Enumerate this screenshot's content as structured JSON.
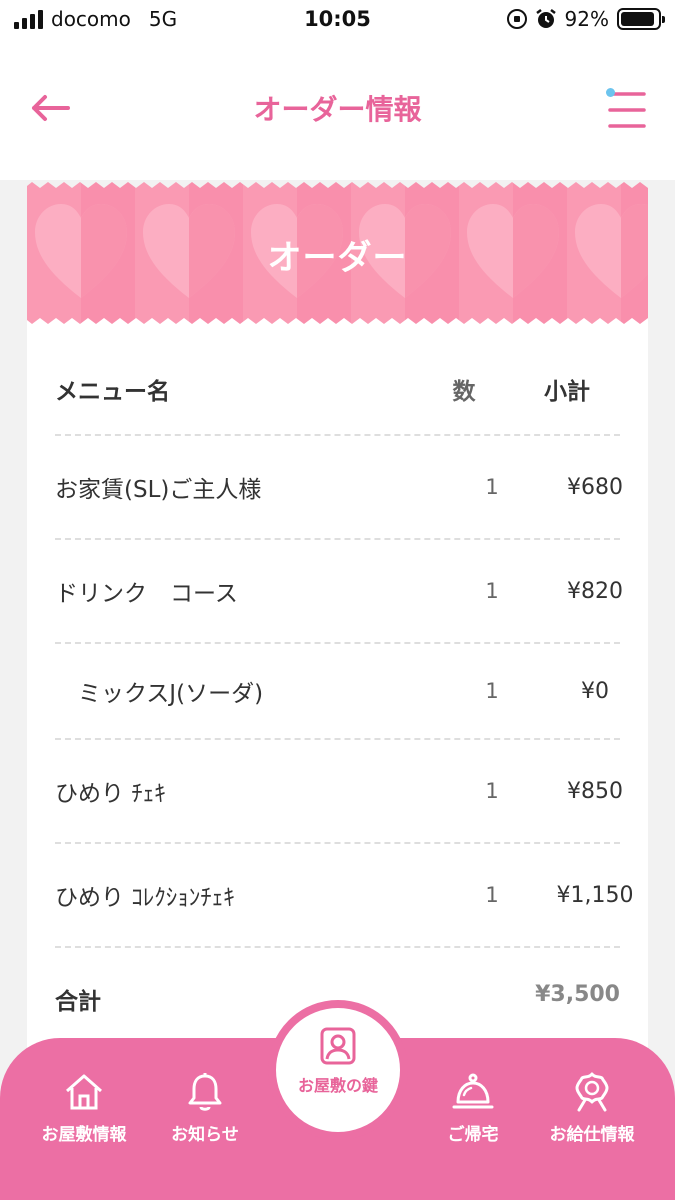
{
  "status_bar": {
    "carrier": "docomo",
    "network": "5G",
    "time": "10:05",
    "battery": "92%",
    "battery_level": 0.92
  },
  "header": {
    "title": "オーダー情報",
    "back_icon": "arrow-left-icon",
    "menu_icon": "hamburger-menu-icon"
  },
  "banner": {
    "title": "オーダー"
  },
  "table": {
    "columns": [
      "メニュー名",
      "数",
      "小計"
    ],
    "rows": [
      {
        "name": "お家賃(SL)ご主人様",
        "qty": "1",
        "subtotal": "¥680"
      },
      {
        "name": "ドリンク　コース",
        "qty": "1",
        "subtotal": "¥820"
      },
      {
        "name": "　ミックスJ(ソーダ)",
        "qty": "1",
        "subtotal": "¥0"
      },
      {
        "name": "ひめり ﾁｪｷ",
        "qty": "1",
        "subtotal": "¥850"
      },
      {
        "name": "ひめり ｺﾚｸｼｮﾝﾁｪｷ",
        "qty": "1",
        "subtotal": "¥1,150"
      }
    ],
    "total_label": "合計",
    "total_value": "¥3,500"
  },
  "bottom_nav": {
    "items": [
      {
        "label": "お屋敷情報",
        "icon": "house-icon"
      },
      {
        "label": "お知らせ",
        "icon": "bell-icon"
      },
      {
        "label": "お屋敷の鍵",
        "icon": "member-card-icon"
      },
      {
        "label": "ご帰宅",
        "icon": "service-bell-icon"
      },
      {
        "label": "お給仕情報",
        "icon": "ribbon-badge-icon"
      }
    ]
  },
  "colors": {
    "accent": "#e8649a",
    "nav_background": "#ec6fa4",
    "banner_pink": "#f98fac",
    "dot_blue": "#6cc4ee"
  }
}
